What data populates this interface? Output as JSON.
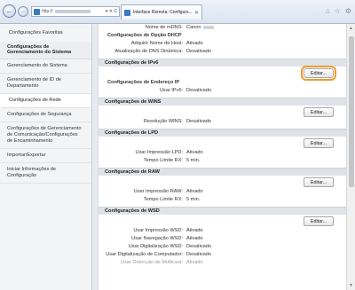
{
  "browser": {
    "address_prefix": "http://",
    "address_controls": "▾ ✕ C",
    "tab_title": "Interface Remota: Configurs...",
    "tab_close": "✕",
    "icons": [
      "home-icon",
      "star-icon",
      "gear-icon"
    ]
  },
  "sidebar": {
    "favorites": "Configurações Favoritas",
    "section": "Configurações de Gerenciamento do Sistema",
    "items": [
      "Gerenciamento do Sistema",
      "Gerenciamento de ID de Departamento",
      "Configurações de Rede",
      "Configurações de Segurança",
      "Configurações de Gerenciamento de Comunicação/Configurações de Encaminhamento",
      "Importar/Exportar",
      "Iniciar Informações de Configuração"
    ]
  },
  "content": {
    "top_rows": [
      {
        "label": "Nome de mDNS:",
        "value": "Canon"
      }
    ],
    "dhcp_heading": "Configurações de Opção DHCP",
    "dhcp_rows": [
      {
        "label": "Adquirir Nome de Host:",
        "value": "Ativado"
      },
      {
        "label": "Atualização de DNS Dinâmica:",
        "value": "Desativado"
      }
    ],
    "ipv6_section": "Configurações de IPv6",
    "edit_label": "Editar...",
    "ipv6_sub": "Configurações de Endereço IP",
    "ipv6_rows": [
      {
        "label": "Usar IPv6:",
        "value": "Desativado"
      }
    ],
    "wins_section": "Configurações de WINS",
    "wins_rows": [
      {
        "label": "Resolução WINS:",
        "value": "Desativado"
      }
    ],
    "lpd_section": "Configurações de LPD",
    "lpd_rows": [
      {
        "label": "Usar Impressão LPD:",
        "value": "Ativado"
      },
      {
        "label": "Tempo Limite RX:",
        "value": "5 min."
      }
    ],
    "raw_section": "Configurações de RAW",
    "raw_rows": [
      {
        "label": "Usar Impressão RAW:",
        "value": "Ativado"
      },
      {
        "label": "Tempo Limite RX:",
        "value": "5 min."
      }
    ],
    "wsd_section": "Configurações de WSD",
    "wsd_rows": [
      {
        "label": "Usar Impressão WSD:",
        "value": "Ativado"
      },
      {
        "label": "Usar Navegação WSD:",
        "value": "Ativado"
      },
      {
        "label": "Usar Digitalização WSD:",
        "value": "Desativado"
      },
      {
        "label": "Usar Digitalização de Computador:",
        "value": "Desativado"
      },
      {
        "label": "Usar Detecção de Multicast:",
        "value": "Ativado"
      }
    ]
  },
  "colors": {
    "highlight": "#f29b2c",
    "section_bg": "#dfe3e8"
  }
}
